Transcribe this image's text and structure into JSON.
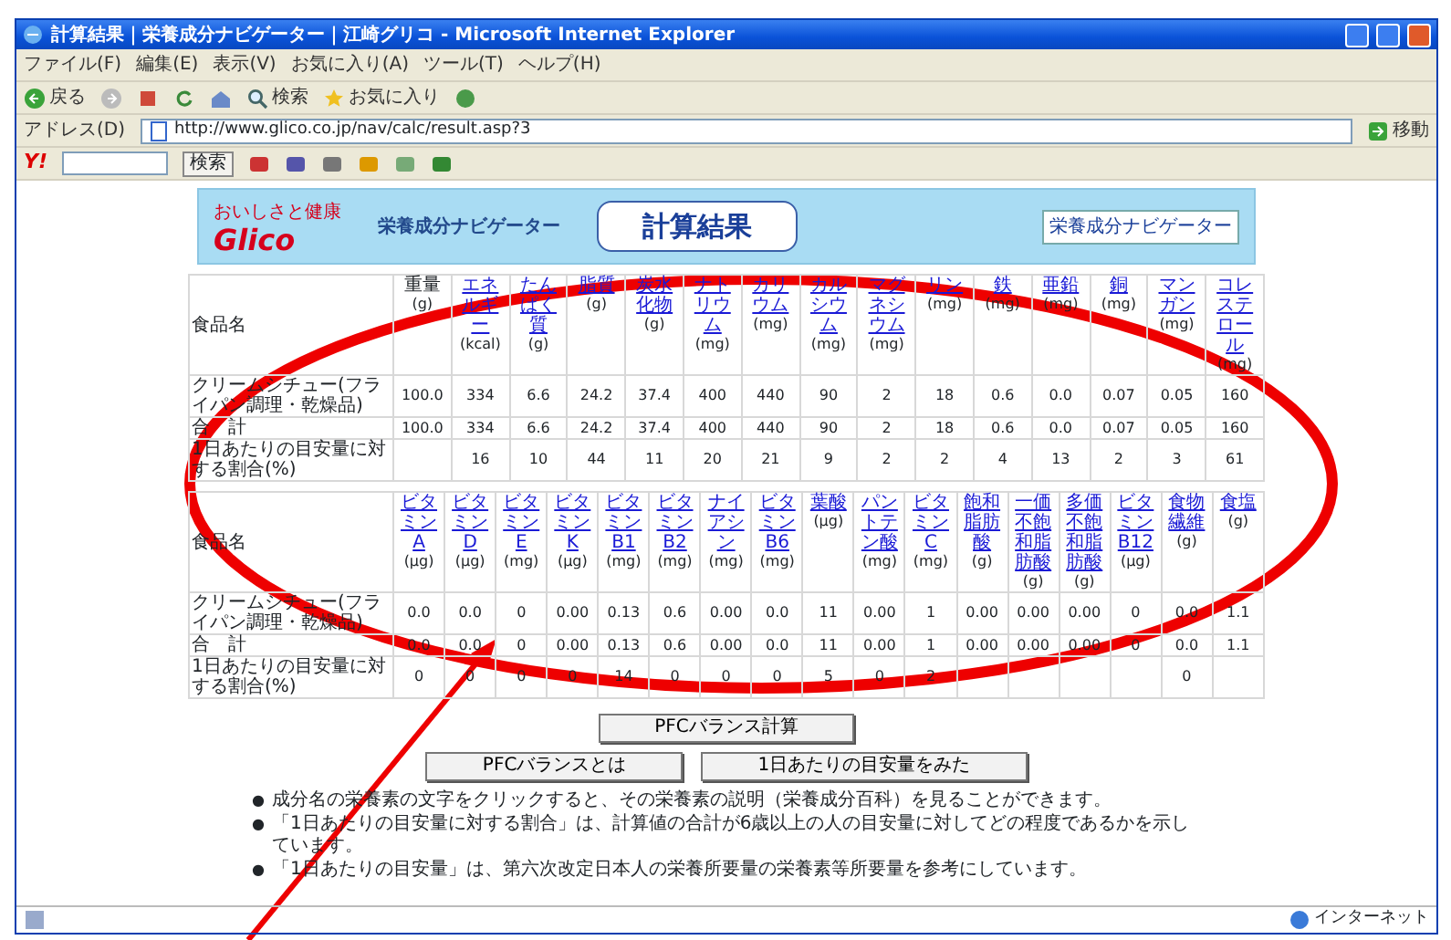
{
  "window": {
    "title": "計算結果｜栄養成分ナビゲーター｜江崎グリコ - Microsoft Internet Explorer"
  },
  "menu": [
    "ファイル(F)",
    "編集(E)",
    "表示(V)",
    "お気に入り(A)",
    "ツール(T)",
    "ヘルプ(H)"
  ],
  "toolbar": [
    {
      "kind": "back",
      "label": "戻る"
    },
    {
      "kind": "forward"
    },
    {
      "kind": "stop"
    },
    {
      "kind": "refresh"
    },
    {
      "kind": "home"
    },
    {
      "kind": "search",
      "label": "検索"
    },
    {
      "kind": "favorites",
      "label": "お気に入り"
    },
    {
      "kind": "media"
    }
  ],
  "address": {
    "label": "アドレス(D)",
    "url": "http://www.glico.co.jp/nav/calc/result.asp?3",
    "go": "移動"
  },
  "yahoo_bar": {
    "logo": "Y!",
    "search_button": "検索"
  },
  "page": {
    "logo_caption": "おいしさと健康",
    "logo": "Glico",
    "banner_subtitle": "栄養成分ナビゲーター",
    "banner_title": "計算結果",
    "banner_link": "栄養成分ナビゲーター"
  },
  "tables": [
    {
      "name_header": "食品名",
      "columns": [
        {
          "label": "重量",
          "unit": "(g)",
          "link": false
        },
        {
          "label": "エネルギー",
          "unit": "(kcal)",
          "link": true
        },
        {
          "label": "たんぱく質",
          "unit": "(g)",
          "link": true
        },
        {
          "label": "脂質",
          "unit": "(g)",
          "link": true
        },
        {
          "label": "炭水化物",
          "unit": "(g)",
          "link": true
        },
        {
          "label": "ナトリウム",
          "unit": "(mg)",
          "link": true
        },
        {
          "label": "カリウム",
          "unit": "(mg)",
          "link": true
        },
        {
          "label": "カルシウム",
          "unit": "(mg)",
          "link": true
        },
        {
          "label": "マグネシウム",
          "unit": "(mg)",
          "link": true
        },
        {
          "label": "リン",
          "unit": "(mg)",
          "link": true
        },
        {
          "label": "鉄",
          "unit": "(mg)",
          "link": true
        },
        {
          "label": "亜鉛",
          "unit": "(mg)",
          "link": true
        },
        {
          "label": "銅",
          "unit": "(mg)",
          "link": true
        },
        {
          "label": "マンガン",
          "unit": "(mg)",
          "link": true
        },
        {
          "label": "コレステロール",
          "unit": "(mg)",
          "link": true
        }
      ],
      "rows": [
        {
          "name": "クリームシチュー(フライパン調理・乾燥品)",
          "cells": [
            "100.0",
            "334",
            "6.6",
            "24.2",
            "37.4",
            "400",
            "440",
            "90",
            "2",
            "18",
            "0.6",
            "0.0",
            "0.07",
            "0.05",
            "160"
          ]
        },
        {
          "name": "合　計",
          "cells": [
            "100.0",
            "334",
            "6.6",
            "24.2",
            "37.4",
            "400",
            "440",
            "90",
            "2",
            "18",
            "0.6",
            "0.0",
            "0.07",
            "0.05",
            "160"
          ]
        },
        {
          "name": "1日あたりの目安量に対する割合(%)",
          "cells": [
            null,
            "16",
            "10",
            "44",
            "11",
            "20",
            "21",
            "9",
            "2",
            "2",
            "4",
            "13",
            "2",
            "3",
            "61"
          ]
        }
      ]
    },
    {
      "name_header": "食品名",
      "columns": [
        {
          "label": "ビタミンA",
          "unit": "(μg)",
          "link": true
        },
        {
          "label": "ビタミンD",
          "unit": "(μg)",
          "link": true
        },
        {
          "label": "ビタミンE",
          "unit": "(mg)",
          "link": true
        },
        {
          "label": "ビタミンK",
          "unit": "(μg)",
          "link": true
        },
        {
          "label": "ビタミンB1",
          "unit": "(mg)",
          "link": true
        },
        {
          "label": "ビタミンB2",
          "unit": "(mg)",
          "link": true
        },
        {
          "label": "ナイアシン",
          "unit": "(mg)",
          "link": true
        },
        {
          "label": "ビタミンB6",
          "unit": "(mg)",
          "link": true
        },
        {
          "label": "葉酸",
          "unit": "(μg)",
          "link": true
        },
        {
          "label": "パントテン酸",
          "unit": "(mg)",
          "link": true
        },
        {
          "label": "ビタミンC",
          "unit": "(mg)",
          "link": true
        },
        {
          "label": "飽和脂肪酸",
          "unit": "(g)",
          "link": true
        },
        {
          "label": "一価不飽和脂肪酸",
          "unit": "(g)",
          "link": true
        },
        {
          "label": "多価不飽和脂肪酸",
          "unit": "(g)",
          "link": true
        },
        {
          "label": "ビタミンB12",
          "unit": "(μg)",
          "link": true
        },
        {
          "label": "食物繊維",
          "unit": "(g)",
          "link": true
        },
        {
          "label": "食塩",
          "unit": "(g)",
          "link": true
        }
      ],
      "rows": [
        {
          "name": "クリームシチュー(フライパン調理・乾燥品)",
          "cells": [
            "0.0",
            "0.0",
            "0",
            "0.00",
            "0.13",
            "0.6",
            "0.00",
            "0.0",
            "11",
            "0.00",
            "1",
            "0.00",
            "0.00",
            "0.00",
            "0",
            "0.0",
            "1.1"
          ]
        },
        {
          "name": "合　計",
          "cells": [
            "0.0",
            "0.0",
            "0",
            "0.00",
            "0.13",
            "0.6",
            "0.00",
            "0.0",
            "11",
            "0.00",
            "1",
            "0.00",
            "0.00",
            "0.00",
            "0",
            "0.0",
            "1.1"
          ]
        },
        {
          "name": "1日あたりの目安量に対する割合(%)",
          "cells": [
            "0",
            "0",
            "0",
            "0",
            "14",
            "0",
            "0",
            "0",
            "5",
            "0",
            "2",
            null,
            null,
            null,
            null,
            "0",
            null
          ]
        }
      ]
    }
  ],
  "buttons": [
    {
      "label": "PFCバランス計算"
    },
    {
      "label": "PFCバランスとは"
    },
    {
      "label": "1日あたりの目安量をみた"
    }
  ],
  "notes": [
    {
      "marker": "●",
      "text": "成分名の栄養素の文字をクリックすると、その栄養素の説明（栄養成分百科）を見ることができます。"
    },
    {
      "marker": "●",
      "text": "「1日あたりの目安量に対する割合」は、計算値の合計が6歳以上の人の目安量に対してどの程度であるかを示しています。"
    },
    {
      "marker": "●",
      "text": "「1日あたりの目安量」は、第六次改定日本人の栄養所要量の栄養素等所要量を参考にしています。"
    }
  ],
  "status_bar": {
    "zone": "インターネット"
  }
}
